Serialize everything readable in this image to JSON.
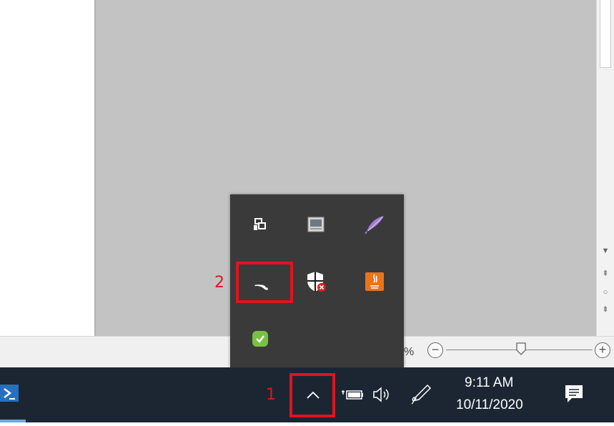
{
  "status_bar": {
    "zoom_percent_text": "%",
    "zoom_minus": "−",
    "zoom_plus": "+"
  },
  "tray_popup": {
    "icons": [
      "monitors-icon",
      "window-icon",
      "feather-icon",
      "wifi-icon",
      "security-shield-icon",
      "java-icon",
      "green-check-icon"
    ]
  },
  "annotations": {
    "step1": "1",
    "step2": "2"
  },
  "taskbar": {
    "time": "9:11 AM",
    "date": "10/11/2020"
  },
  "colors": {
    "highlight": "#e0141e",
    "taskbar": "#1c2633",
    "popup": "#3a3a3a"
  }
}
